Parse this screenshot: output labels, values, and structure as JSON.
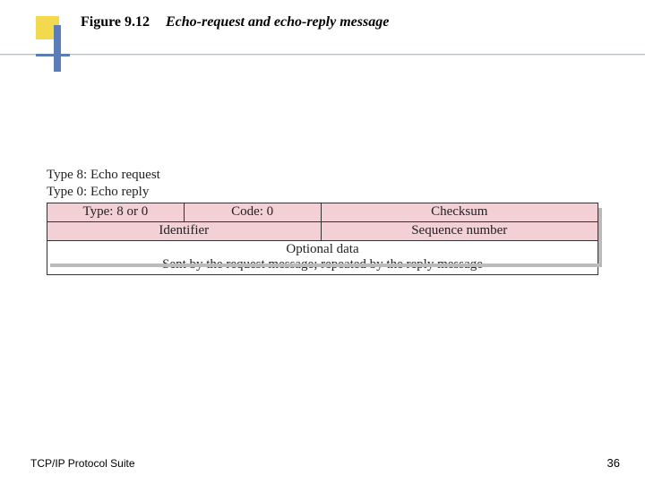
{
  "figure": {
    "label": "Figure 9.12",
    "title": "Echo-request and echo-reply message"
  },
  "types": {
    "line1": "Type 8: Echo request",
    "line2": "Type 0: Echo reply"
  },
  "table": {
    "row1": {
      "type": "Type: 8 or 0",
      "code": "Code: 0",
      "checksum": "Checksum"
    },
    "row2": {
      "identifier": "Identifier",
      "sequence": "Sequence number"
    },
    "row3": {
      "line1": "Optional data",
      "line2": "Sent by the request message; repeated by the reply message"
    }
  },
  "footer": {
    "left": "TCP/IP Protocol Suite",
    "page": "36"
  }
}
